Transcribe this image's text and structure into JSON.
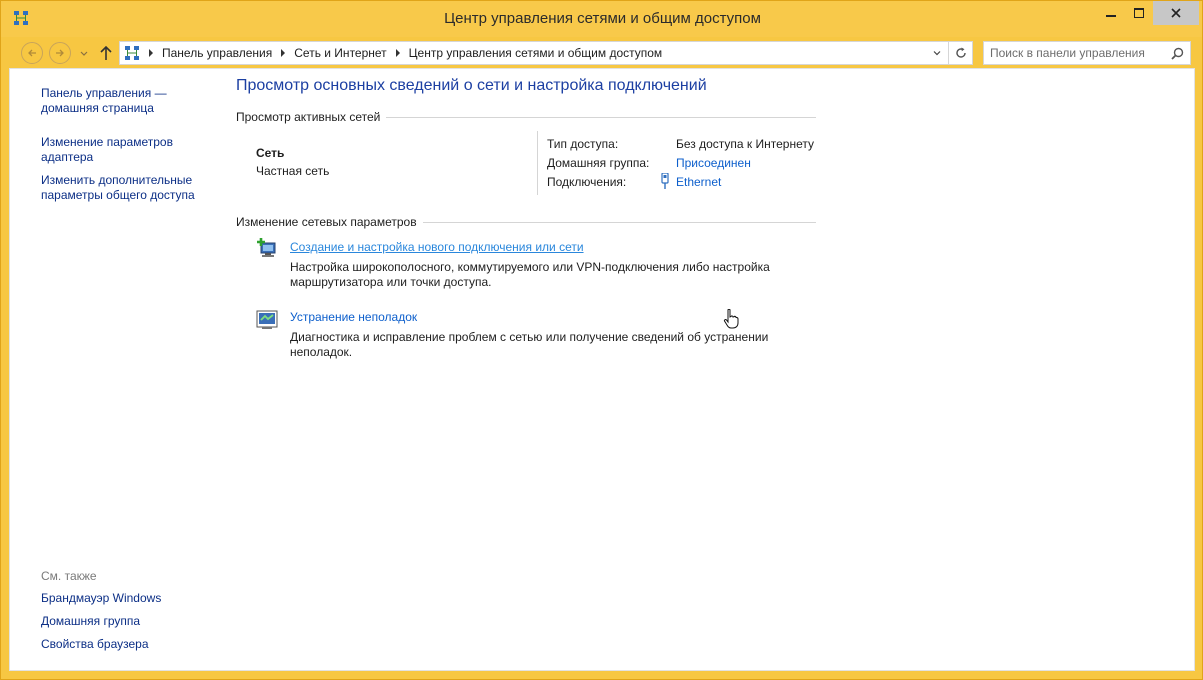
{
  "window": {
    "title": "Центр управления сетями и общим доступом",
    "icon": "network-icon",
    "controls": [
      "minimize-icon",
      "maximize-icon",
      "close-icon"
    ]
  },
  "nav": {
    "breadcrumbs": [
      "Панель управления",
      "Сеть и Интернет",
      "Центр управления сетями и общим доступом"
    ],
    "search_placeholder": "Поиск в панели управления"
  },
  "sidebar": {
    "home_link": "Панель управления — домашняя страница",
    "links": [
      "Изменение параметров адаптера",
      "Изменить дополнительные параметры общего доступа"
    ],
    "see_also_header": "См. также",
    "see_also": [
      "Брандмауэр Windows",
      "Домашняя группа",
      "Свойства браузера"
    ]
  },
  "main": {
    "title": "Просмотр основных сведений о сети и настройка подключений",
    "active_networks_header": "Просмотр активных сетей",
    "network": {
      "name": "Сеть",
      "type": "Частная сеть",
      "access_type_label": "Тип доступа:",
      "access_type_value": "Без доступа к Интернету",
      "homegroup_label": "Домашняя группа:",
      "homegroup_value": "Присоединен",
      "connections_label": "Подключения:",
      "connections_value": "Ethernet"
    },
    "change_settings_header": "Изменение сетевых параметров",
    "tasks": [
      {
        "icon": "new-connection-icon",
        "link": "Создание и настройка нового подключения или сети",
        "desc": "Настройка широкополосного, коммутируемого или VPN-подключения либо настройка маршрутизатора или точки доступа."
      },
      {
        "icon": "troubleshoot-icon",
        "link": "Устранение неполадок",
        "desc": "Диагностика и исправление проблем с сетью или получение сведений об устранении неполадок."
      }
    ]
  },
  "colors": {
    "window_frame": "#f7c742",
    "link": "#0d5fcc",
    "title_blue": "#1c3fa2"
  }
}
